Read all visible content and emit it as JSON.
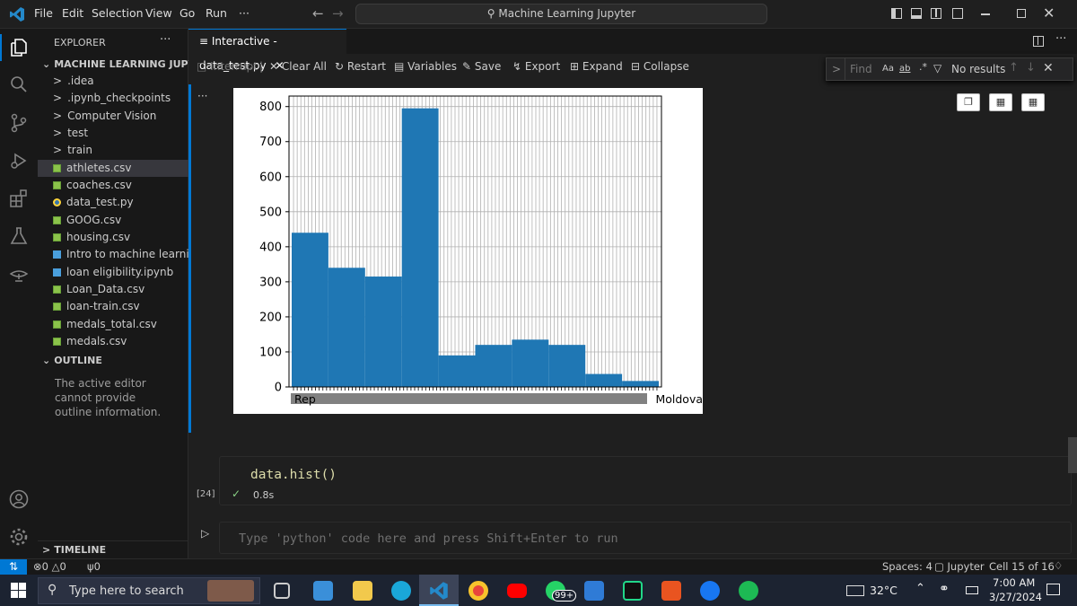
{
  "titlebar": {
    "menus": [
      "File",
      "Edit",
      "Selection",
      "View",
      "Go",
      "Run",
      "···"
    ],
    "search": "Machine Learning Jupyter"
  },
  "sidebar": {
    "header": "EXPLORER",
    "project": "MACHINE LEARNING JUPYTER",
    "items": [
      {
        "label": ".idea",
        "kind": "folder"
      },
      {
        "label": ".ipynb_checkpoints",
        "kind": "folder"
      },
      {
        "label": "Computer Vision",
        "kind": "folder"
      },
      {
        "label": "test",
        "kind": "folder"
      },
      {
        "label": "train",
        "kind": "folder"
      },
      {
        "label": "athletes.csv",
        "kind": "csv",
        "selected": true
      },
      {
        "label": "coaches.csv",
        "kind": "csv"
      },
      {
        "label": "data_test.py",
        "kind": "py"
      },
      {
        "label": "GOOG.csv",
        "kind": "csv"
      },
      {
        "label": "housing.csv",
        "kind": "csv"
      },
      {
        "label": "Intro to machine learnin...",
        "kind": "nb"
      },
      {
        "label": "loan eligibility.ipynb",
        "kind": "nb"
      },
      {
        "label": "Loan_Data.csv",
        "kind": "csv"
      },
      {
        "label": "loan-train.csv",
        "kind": "csv"
      },
      {
        "label": "medals_total.csv",
        "kind": "csv"
      },
      {
        "label": "medals.csv",
        "kind": "csv"
      }
    ],
    "outline_header": "OUTLINE",
    "outline_text": "The active editor cannot provide outline information.",
    "timeline_header": "TIMELINE"
  },
  "editor": {
    "tab_label": "Interactive - data_test.py",
    "toolbar": {
      "interrupt": "Interrupt",
      "clear_all": "Clear All",
      "restart": "Restart",
      "variables": "Variables",
      "save": "Save",
      "export": "Export",
      "expand": "Expand",
      "collapse": "Collapse"
    },
    "find": {
      "placeholder": "Find",
      "aa": "Aa",
      "ab": "ab",
      "regex": ".*",
      "result": "No results"
    },
    "cell_more": "···",
    "code": "data.hist()",
    "exec_count": "[24]",
    "exec_time": "0.8s",
    "input_placeholder": "Type 'python' code here and press Shift+Enter to run"
  },
  "chart_data": {
    "type": "bar",
    "title": "",
    "xlabel": "",
    "ylabel": "",
    "ylim": [
      0,
      830
    ],
    "y_ticks": [
      0,
      100,
      200,
      300,
      400,
      500,
      600,
      700,
      800
    ],
    "grid": true,
    "x_tick_labels_overlapping": true,
    "x_tick_first_visible": "Rep",
    "x_tick_last_visible": "Moldova",
    "bar_color": "#1f77b4",
    "bins": [
      {
        "count": 10,
        "value": 440
      },
      {
        "count": 10,
        "value": 340
      },
      {
        "count": 10,
        "value": 315
      },
      {
        "count": 10,
        "value": 795
      },
      {
        "count": 10,
        "value": 90
      },
      {
        "count": 10,
        "value": 120
      },
      {
        "count": 10,
        "value": 135
      },
      {
        "count": 10,
        "value": 120
      },
      {
        "count": 10,
        "value": 37
      },
      {
        "count": 10,
        "value": 17
      }
    ]
  },
  "statusbar": {
    "errors": "0",
    "warnings": "0",
    "ports": "0",
    "spaces": "Spaces: 4",
    "kernel": "Jupyter",
    "cell": "Cell 15 of 16"
  },
  "taskbar": {
    "search_placeholder": "Type here to search",
    "badge": "99+",
    "temp": "32°C",
    "time": "7:00 AM",
    "date": "3/27/2024"
  }
}
